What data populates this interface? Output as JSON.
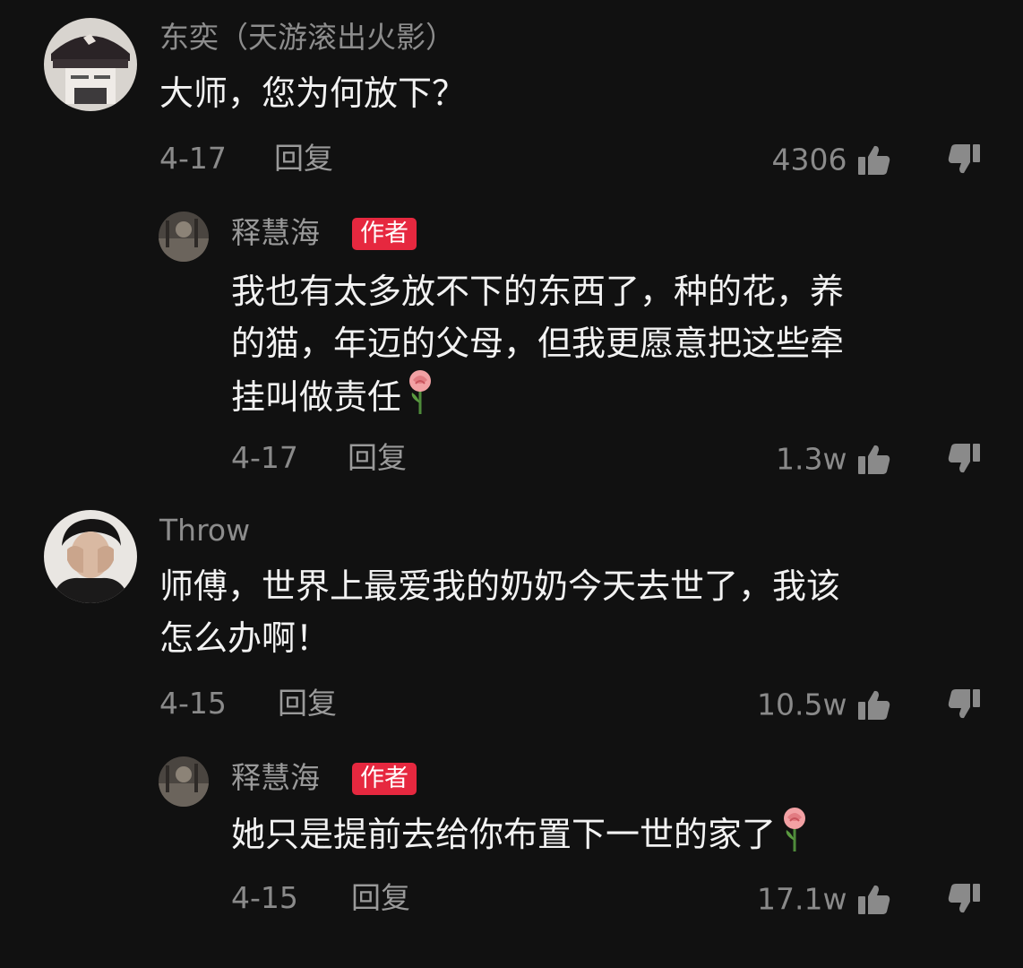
{
  "colors": {
    "background": "#111111",
    "username": "#8d8d8d",
    "body_text": "#f2f2f2",
    "meta_text": "#8a8a8a",
    "author_badge": "#e6283f"
  },
  "icons": {
    "like": "thumbs-up-icon",
    "dislike": "thumbs-down-icon",
    "rose": "rose-icon"
  },
  "comments": [
    {
      "username": "东奕（天游滚出火影）",
      "text_lines": [
        "大师，您为何放下？"
      ],
      "date": "4-17",
      "reply_label": "回复",
      "likes": "4306",
      "reply": {
        "username": "释慧海",
        "badge": "作者",
        "text_lines": [
          "我也有太多放不下的东西了，种的花，养",
          "的猫，年迈的父母，但我更愿意把这些牵",
          "挂叫做责任"
        ],
        "date": "4-17",
        "reply_label": "回复",
        "likes": "1.3w"
      }
    },
    {
      "username": "Throw",
      "text_lines": [
        "师傅，世界上最爱我的奶奶今天去世了，我该",
        "怎么办啊！"
      ],
      "date": "4-15",
      "reply_label": "回复",
      "likes": "10.5w",
      "reply": {
        "username": "释慧海",
        "badge": "作者",
        "text_lines": [
          "她只是提前去给你布置下一世的家了"
        ],
        "date": "4-15",
        "reply_label": "回复",
        "likes": "17.1w"
      }
    }
  ]
}
